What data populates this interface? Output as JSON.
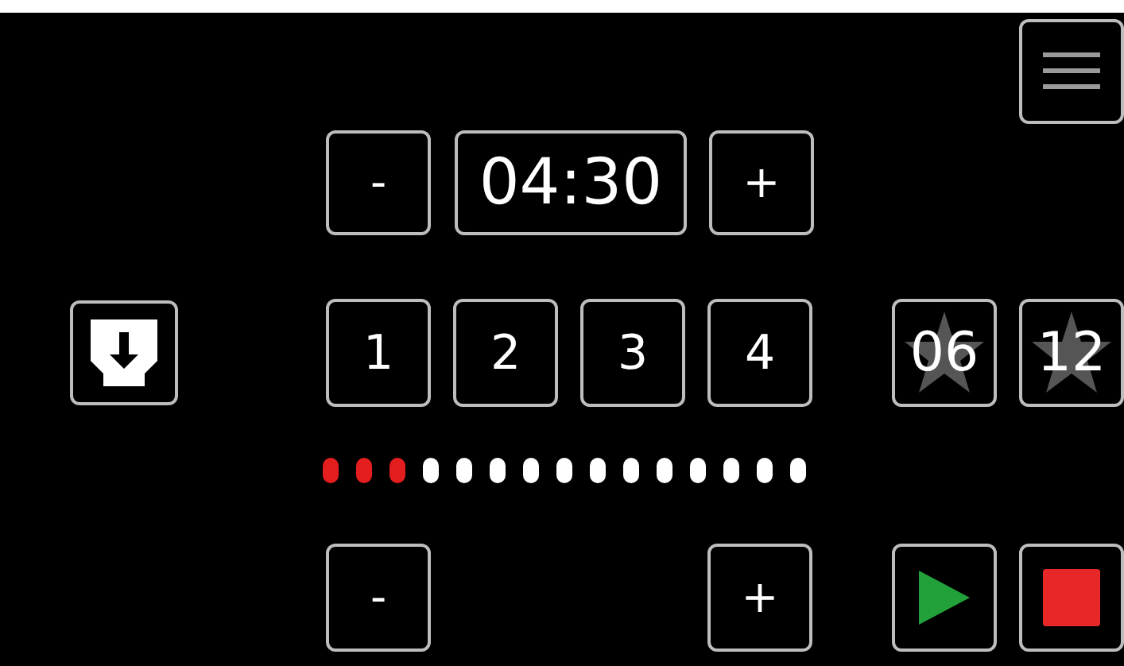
{
  "timer": {
    "decrease": "-",
    "value": "04:30",
    "increase": "+"
  },
  "presets": [
    "1",
    "2",
    "3",
    "4"
  ],
  "favorites": [
    "06",
    "12"
  ],
  "meter": {
    "level": 0.2
  },
  "volume": {
    "decrease": "-",
    "increase": "+"
  }
}
